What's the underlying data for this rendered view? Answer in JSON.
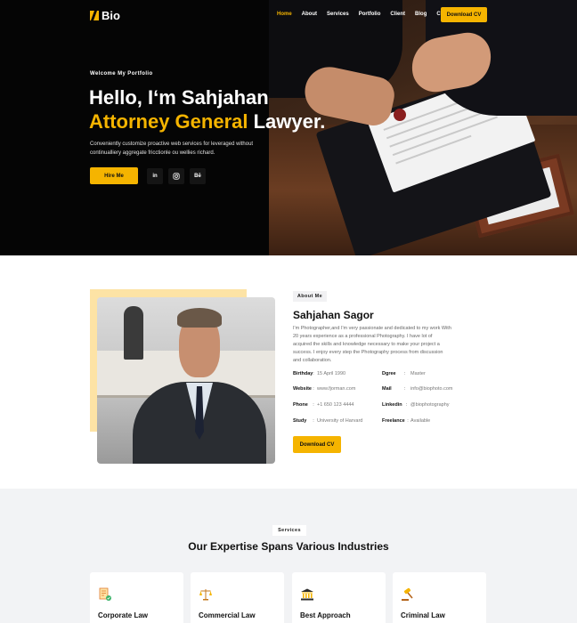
{
  "nav": {
    "logo": "Bio",
    "links": [
      "Home",
      "About",
      "Services",
      "Portfolio",
      "Client",
      "Blog",
      "Contact"
    ],
    "active": "Home",
    "cv_button": "Download CV"
  },
  "hero": {
    "welcome": "Welcome My Portfolio",
    "greeting": "Hello, I‘m Sahjahan",
    "title_accent": "Attorney General",
    "title_rest": " Lawyer.",
    "description": "Conveniently customize proactive web services for leveraged without continualliery aggregate fricctionle ou wellies richard.",
    "hire_button": "Hire Me",
    "socials": [
      {
        "name": "linkedin-icon",
        "label": "in"
      },
      {
        "name": "instagram-icon",
        "label": ""
      },
      {
        "name": "behance-icon",
        "label": "Bē"
      }
    ]
  },
  "about": {
    "tag": "About Me",
    "name": "Sahjahan Sagor",
    "bio": "I'm Photographer,and I'm very passionate and dedicated to my work With 20 years experience as a professional Photography. I have lot of acquired the skills and knowledge necessary to make your project a success. I enjoy every step the Photography process from discussion and collaboration.",
    "info_left": [
      {
        "key": "Birthday",
        "value": "15 April 1990"
      },
      {
        "key": "Website",
        "value": "www.fjorman.com"
      },
      {
        "key": "Phone",
        "value": "+1 650 123 4444"
      },
      {
        "key": "Study",
        "value": "University of Harvard"
      }
    ],
    "info_right": [
      {
        "key": "Dgree",
        "value": "Master"
      },
      {
        "key": "Mail",
        "value": "info@biophoto.com"
      },
      {
        "key": "Linkedin",
        "value": "@biophotography"
      },
      {
        "key": "Freelance",
        "value": "Available"
      }
    ],
    "cv_button": "Download CV"
  },
  "services": {
    "tag": "Services",
    "title": "Our Expertise Spans Various Industries",
    "cards": [
      {
        "label": "Corporate Law",
        "icon": "document-icon"
      },
      {
        "label": "Commercial Law",
        "icon": "scales-icon"
      },
      {
        "label": "Best Approach",
        "icon": "courthouse-icon"
      },
      {
        "label": "Criminal Law",
        "icon": "gavel-icon"
      }
    ]
  },
  "colors": {
    "accent": "#f5b400",
    "dark": "#050505",
    "light_bg": "#f2f3f5"
  }
}
